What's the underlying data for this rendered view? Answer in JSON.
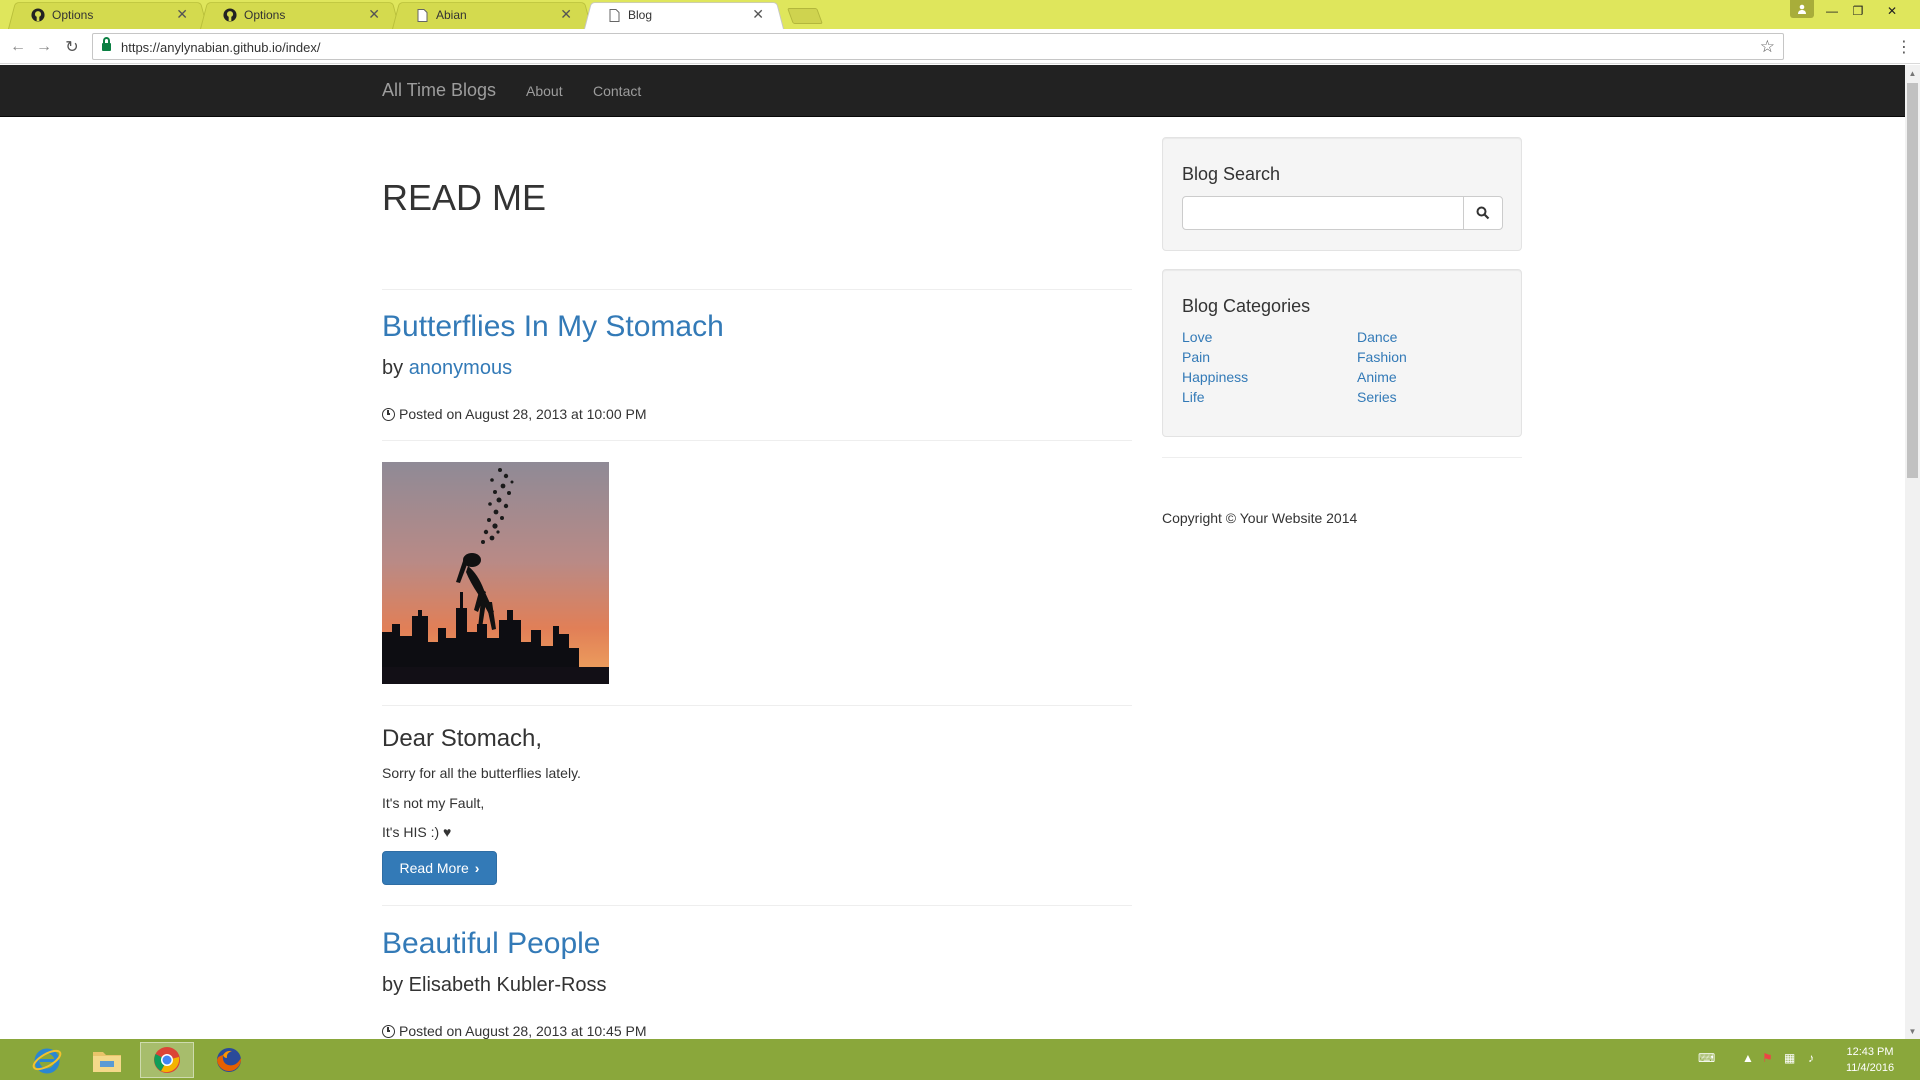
{
  "browser": {
    "tabs": [
      {
        "title": "Options",
        "icon": "github-icon",
        "active": false
      },
      {
        "title": "Options",
        "icon": "github-icon",
        "active": false
      },
      {
        "title": "Abian",
        "icon": "page-icon",
        "active": false
      },
      {
        "title": "Blog",
        "icon": "page-icon",
        "active": true
      }
    ],
    "url": "https://anylynabian.github.io/index/"
  },
  "site": {
    "brand": "All Time Blogs",
    "nav": [
      "About",
      "Contact"
    ],
    "heading": "READ ME",
    "posts": [
      {
        "title": "Butterflies In My Stomach",
        "by_prefix": "by",
        "author": "anonymous",
        "posted": "Posted on August 28, 2013 at 10:00 PM",
        "excerpt_heading": "Dear Stomach,",
        "excerpt_lines": [
          "Sorry for all the butterflies lately.",
          "It's not my Fault,",
          "It's HIS :) ♥"
        ],
        "button": "Read More"
      },
      {
        "title": "Beautiful People",
        "byline": "by Elisabeth Kubler-Ross",
        "posted": "Posted on August 28, 2013 at 10:45 PM"
      }
    ],
    "sidebar": {
      "search_title": "Blog Search",
      "categories_title": "Blog Categories",
      "categories_left": [
        "Love",
        "Pain",
        "Happiness",
        "Life"
      ],
      "categories_right": [
        "Dance",
        "Fashion",
        "Anime",
        "Series"
      ]
    },
    "copyright": "Copyright © Your Website 2014"
  },
  "taskbar": {
    "time": "12:43 PM",
    "date": "11/4/2016"
  },
  "colors": {
    "link": "#337ab7",
    "navbar": "#222222",
    "tabstrip": "#dfe65c",
    "taskbar": "#8aa73b"
  }
}
